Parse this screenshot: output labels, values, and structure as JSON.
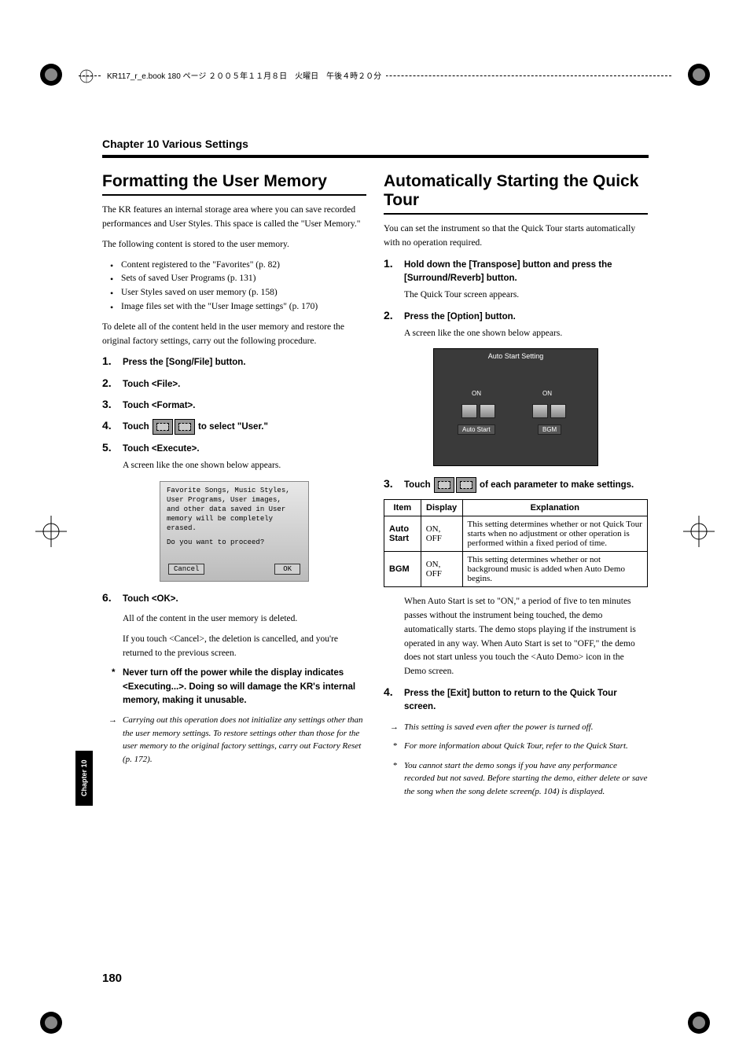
{
  "header": {
    "running": "KR117_r_e.book  180 ページ  ２００５年１１月８日　火曜日　午後４時２０分"
  },
  "chapter": "Chapter 10 Various Settings",
  "side_tab": "Chapter 10",
  "page_number": "180",
  "left": {
    "title": "Formatting the User Memory",
    "intro1": "The KR features an internal storage area where you can save recorded performances and User Styles. This space is called the \"User Memory.\"",
    "intro2": "The following content is stored to the user memory.",
    "bullets": [
      "Content registered to the \"Favorites\" (p. 82)",
      "Sets of saved User Programs (p. 131)",
      "User Styles saved on user memory (p. 158)",
      "Image files set with the \"User Image settings\" (p. 170)"
    ],
    "intro3": "To delete all of the content held in the user memory and restore the original factory settings, carry out the following procedure.",
    "steps": {
      "s1": "Press the [Song/File] button.",
      "s2": "Touch <File>.",
      "s3": "Touch <Format>.",
      "s4_pre": "Touch ",
      "s4_post": " to select \"User.\"",
      "s5": "Touch <Execute>.",
      "s5_after": "A screen like the one shown below appears.",
      "s6": "Touch <OK>."
    },
    "screenshot": {
      "line1": "Favorite Songs, Music Styles,",
      "line2": "User Programs, User images,",
      "line3": "and other data saved in User",
      "line4": "memory will be completely",
      "line5": "erased.",
      "line6": "Do you want to proceed?",
      "cancel": "Cancel",
      "ok": "OK"
    },
    "after6_1": "All of the content in the user memory is deleted.",
    "after6_2": "If you touch <Cancel>, the deletion is cancelled, and you're returned to the previous screen.",
    "note_bold": "Never turn off the power while the display indicates <Executing...>. Doing so will damage the KR's internal memory, making it unusable.",
    "arrow_note": "Carrying out this operation does not initialize any settings other than the user memory settings. To restore settings other than those for the user memory to the original factory settings, carry out Factory Reset (p. 172)."
  },
  "right": {
    "title": "Automatically Starting the Quick Tour",
    "intro": "You can set the instrument so that the Quick Tour starts automatically with no operation required.",
    "steps": {
      "s1": "Hold down the [Transpose] button and press the [Surround/Reverb] button.",
      "s1_after": "The Quick Tour screen appears.",
      "s2": "Press the [Option] button.",
      "s2_after": "A screen like the one shown below appears.",
      "s3_pre": "Touch ",
      "s3_post": " of each parameter to make settings.",
      "s4": "Press the [Exit] button to return to the Quick Tour screen."
    },
    "screenshot2": {
      "title": "Auto Start Setting",
      "on1": "ON",
      "on2": "ON",
      "cap1": "Auto Start",
      "cap2": "BGM"
    },
    "table": {
      "head": {
        "c1": "Item",
        "c2": "Display",
        "c3": "Explanation"
      },
      "rows": [
        {
          "item": "Auto Start",
          "display": "ON, OFF",
          "exp": "This setting determines whether or not Quick Tour starts when no adjustment or other operation is performed within a fixed period of time."
        },
        {
          "item": "BGM",
          "display": "ON, OFF",
          "exp": "This setting determines whether or not background music is added when Auto Demo begins."
        }
      ]
    },
    "after_table": "When Auto Start is set to \"ON,\" a period of five to ten minutes passes without the instrument being touched, the demo automatically starts. The demo stops playing if the instrument is operated in any way. When Auto Start is set to \"OFF,\" the demo does not start unless you touch the <Auto Demo> icon in the Demo screen.",
    "arrow_note": "This setting is saved even after the power is turned off.",
    "star1": "For more information about Quick Tour, refer to the Quick Start.",
    "star2": "You cannot start the demo songs if you have any performance recorded but not saved. Before starting the demo, either delete or save the song when the song delete screen(p. 104) is displayed."
  }
}
